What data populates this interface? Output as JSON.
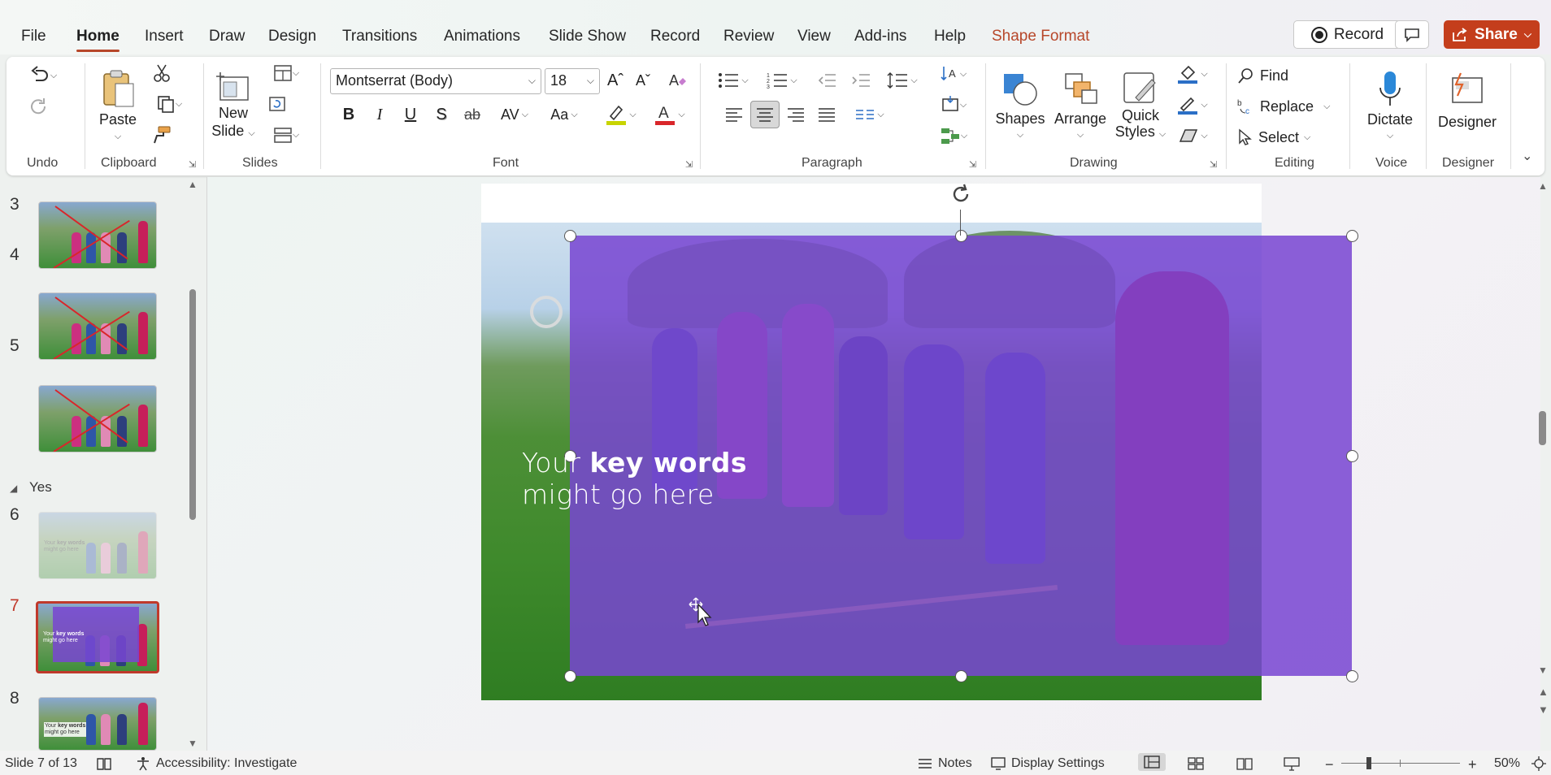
{
  "tabs": [
    {
      "label": "File"
    },
    {
      "label": "Home"
    },
    {
      "label": "Insert"
    },
    {
      "label": "Draw"
    },
    {
      "label": "Design"
    },
    {
      "label": "Transitions"
    },
    {
      "label": "Animations"
    },
    {
      "label": "Slide Show"
    },
    {
      "label": "Record"
    },
    {
      "label": "Review"
    },
    {
      "label": "View"
    },
    {
      "label": "Add-ins"
    },
    {
      "label": "Help"
    },
    {
      "label": "Shape Format"
    }
  ],
  "active_tab": "Home",
  "topbar": {
    "record_label": "Record",
    "share_label": "Share"
  },
  "ribbon": {
    "groups": {
      "undo": "Undo",
      "clipboard": "Clipboard",
      "slides": "Slides",
      "font": "Font",
      "paragraph": "Paragraph",
      "drawing": "Drawing",
      "editing": "Editing",
      "voice": "Voice",
      "designer": "Designer"
    },
    "paste_label": "Paste",
    "new_slide_label_1": "New",
    "new_slide_label_2": "Slide",
    "font_name": "Montserrat (Body)",
    "font_size": "18",
    "shapes_label": "Shapes",
    "arrange_label": "Arrange",
    "quick_styles_label_1": "Quick",
    "quick_styles_label_2": "Styles",
    "find_label": "Find",
    "replace_label": "Replace",
    "select_label": "Select",
    "dictate_label": "Dictate",
    "designer_label": "Designer",
    "highlight_color": "#c8d400",
    "font_color": "#d9262a"
  },
  "thumbnails": [
    {
      "number": "3"
    },
    {
      "number": "4"
    },
    {
      "number": "5"
    },
    {
      "number": "6"
    },
    {
      "number": "7"
    },
    {
      "number": "8"
    }
  ],
  "section_name": "Yes",
  "thumb_text": {
    "line1_a": "Your ",
    "line1_b": "key words",
    "line2": "might go here"
  },
  "slide": {
    "text_plain": "Your ",
    "text_bold": "key words",
    "text_line2": "might go here",
    "overlay_color": "#7846d2"
  },
  "status": {
    "slide_indicator": "Slide 7 of 13",
    "accessibility": "Accessibility: Investigate",
    "notes": "Notes",
    "display_settings": "Display Settings",
    "zoom": "50%"
  }
}
